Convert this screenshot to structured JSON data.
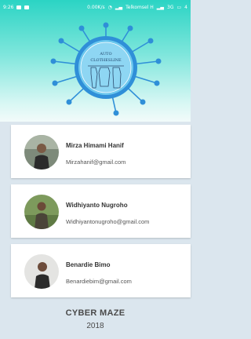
{
  "status_bar": {
    "time": "9:26",
    "speed": "0.00K/s",
    "carrier": "Telkomsel H",
    "network": "3G",
    "battery": "4"
  },
  "logo": {
    "title_line1": "AUTO",
    "title_line2": "CLOTHESLINE"
  },
  "members": [
    {
      "name": "Mirza Himami Hanif",
      "email": "Mirzahanif@gmail.com"
    },
    {
      "name": "Widhiyanto Nugroho",
      "email": "Widhiyantonugroho@gmail.com"
    },
    {
      "name": "Benardie Bimo",
      "email": "Benardiebim@gmail.com"
    }
  ],
  "footer": {
    "team": "CYBER MAZE",
    "year": "2018"
  },
  "colors": {
    "accent": "#2bd4c4",
    "logo_blue": "#2f8fd8",
    "card_bg": "#ffffff",
    "page_bg": "#dbe6ee"
  }
}
